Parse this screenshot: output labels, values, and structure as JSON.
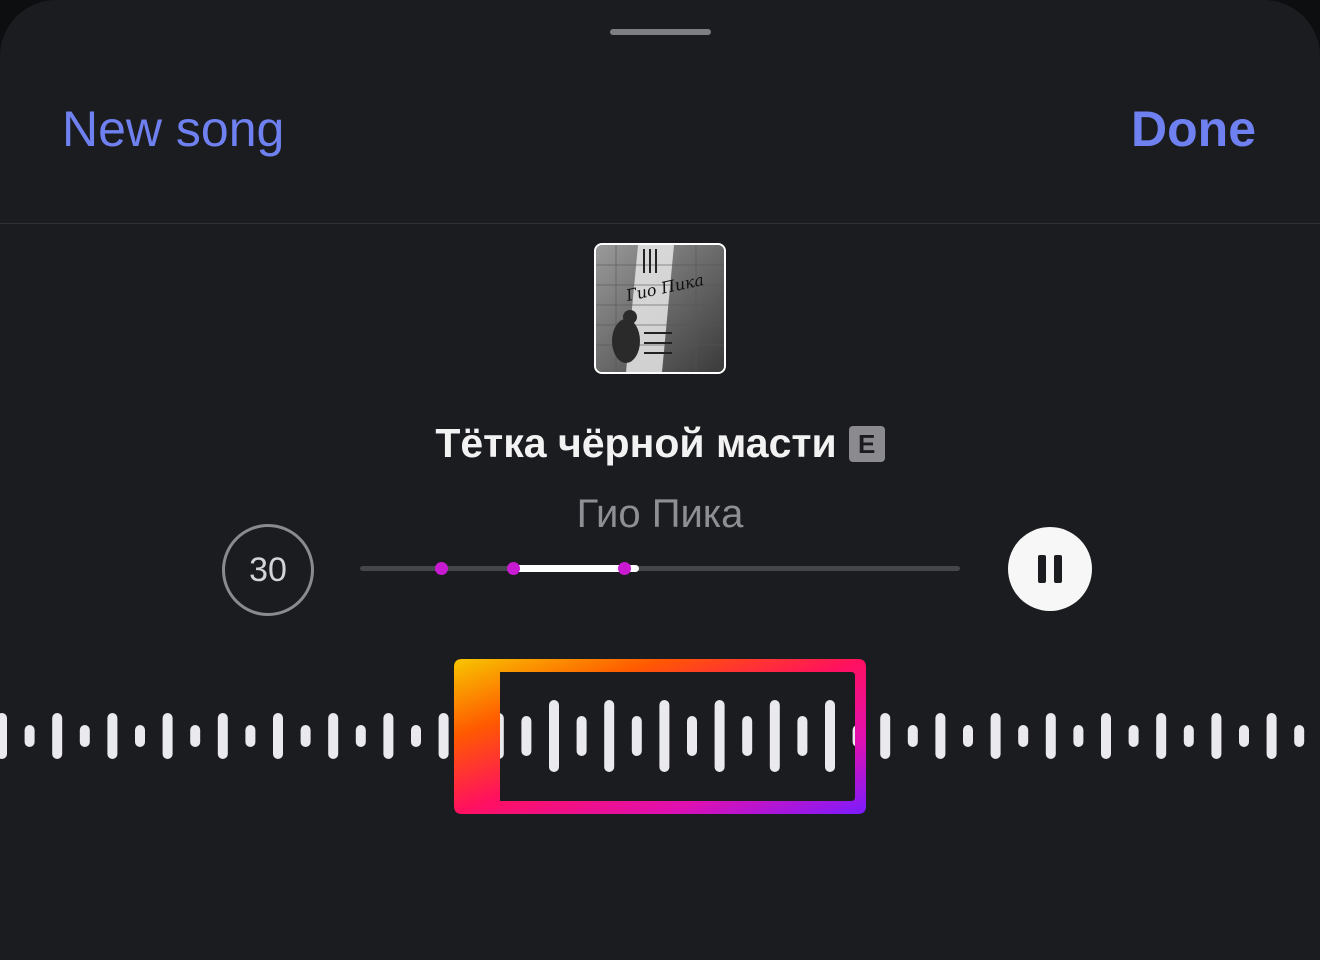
{
  "header": {
    "new_song_label": "New song",
    "done_label": "Done"
  },
  "track": {
    "title": "Тётка чёрной масти",
    "explicit_badge": "E",
    "artist": "Гио Пика",
    "clip_duration": "30",
    "cover_art_text": "Гио Пика"
  },
  "playback": {
    "state": "playing",
    "selection_start": 0.25,
    "selection_end": 0.465,
    "markers": [
      0.135,
      0.255,
      0.44
    ]
  },
  "colors": {
    "accent": "#6f81f0",
    "marker": "#c81ad0",
    "gradient": [
      "#f7c600",
      "#ff5a00",
      "#ff1060",
      "#e010b0",
      "#7a1cff"
    ]
  },
  "icons": {
    "play_pause": "pause-icon"
  }
}
